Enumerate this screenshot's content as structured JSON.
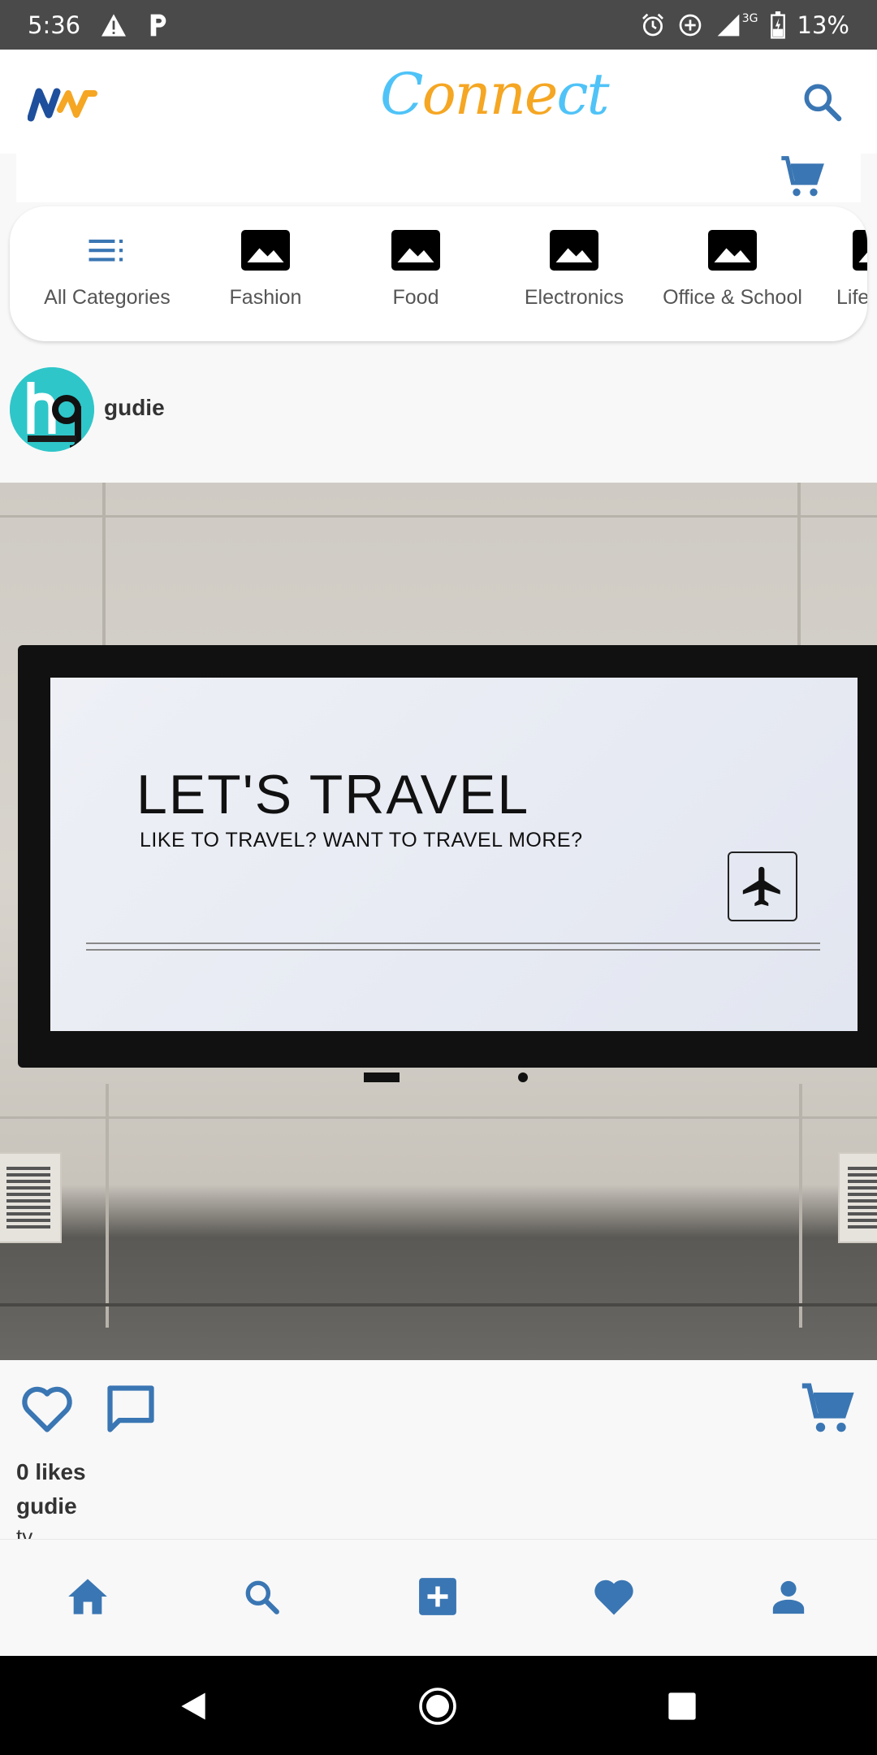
{
  "status_bar": {
    "time": "5:36",
    "battery": "13%",
    "network": "3G",
    "icons": [
      "warning-icon",
      "parking-icon",
      "alarm-icon",
      "data-saver-icon",
      "signal-icon",
      "battery-charging-icon"
    ]
  },
  "header": {
    "brand_prefix": "C",
    "brand_mid": "onne",
    "brand_suffix": "ct",
    "logo_icon": "nn-logo",
    "search_icon": "search-icon",
    "cart_icon": "cart-icon"
  },
  "categories": [
    {
      "label": "All Categories",
      "icon": "list-icon"
    },
    {
      "label": "Fashion",
      "icon": "image-icon"
    },
    {
      "label": "Food",
      "icon": "image-icon"
    },
    {
      "label": "Electronics",
      "icon": "image-icon"
    },
    {
      "label": "Office & School",
      "icon": "image-icon"
    },
    {
      "label": "Life",
      "icon": "image-icon"
    }
  ],
  "post": {
    "username": "gudie",
    "image": {
      "title": "LET'S TRAVEL",
      "subtitle": "LIKE TO TRAVEL? WANT TO TRAVEL MORE?"
    },
    "likes": "0 likes",
    "author": "gudie",
    "caption": "tv"
  },
  "bottom_nav": [
    "home-icon",
    "search-icon",
    "add-box-icon",
    "heart-icon",
    "person-icon"
  ],
  "colors": {
    "accent": "#3a76b3",
    "brand_cyan": "#4fc3f7",
    "brand_orange": "#f5a623",
    "status_bar": "#4a4a4a"
  }
}
